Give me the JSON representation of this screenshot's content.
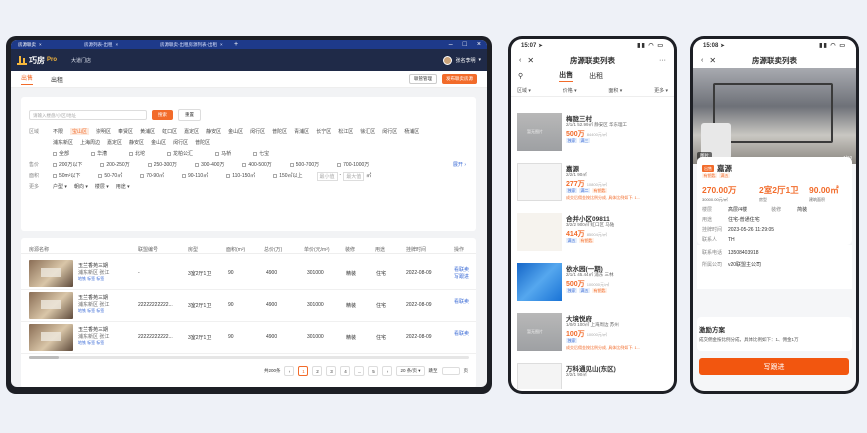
{
  "tablet": {
    "tabs": [
      "房源联卖",
      "房源列表-出租",
      "房源联卖-出租房源列表-出租"
    ],
    "app_name": "巧房",
    "app_suffix": "Pro",
    "store": "大道门店",
    "user": "张名李明",
    "nav": {
      "sale": "出售",
      "rent": "出租",
      "manage_btn": "联管管理",
      "publish_btn": "发布联卖房源"
    },
    "search": {
      "placeholder": "请输入楼盘/小区/地址",
      "search_btn": "搜索",
      "reset_btn": "重置"
    },
    "filters": {
      "area_label": "区域",
      "areas": [
        "不限",
        "宝山区",
        "崇明区",
        "奉贤区",
        "黄浦区",
        "虹口区",
        "嘉定区",
        "静安区",
        "金山区",
        "闵行区",
        "普陀区",
        "青浦区",
        "长宁区",
        "松江区",
        "徐汇区",
        "闵行区",
        "杨浦区"
      ],
      "areas_row2": [
        "浦东新区",
        "上海周边",
        "嘉定区",
        "静安区",
        "金山区",
        "闵行区",
        "普陀区"
      ],
      "types": [
        "全部",
        "华漕",
        "北坨",
        "龙柏公汇",
        "马桥",
        "七宝"
      ],
      "price_label": "售价",
      "prices": [
        "200万以下",
        "200-250万",
        "250-300万",
        "300-400万",
        "400-500万",
        "500-700万",
        "700-1000万"
      ],
      "size_label": "面积",
      "sizes": [
        "50m²以下",
        "50-70㎡",
        "70-90㎡",
        "90-110㎡",
        "110-150㎡",
        "150㎡以上"
      ],
      "min_ph": "最小值",
      "max_ph": "最大值",
      "unit": "㎡",
      "more_label": "更多",
      "more": [
        "户型",
        "朝向",
        "楼层",
        "用途"
      ],
      "expand": "展开"
    },
    "table": {
      "headers": [
        "房源名称",
        "联盟编号",
        "房型",
        "面积(m²)",
        "总价(万)",
        "单价(元/m²)",
        "装修",
        "用途",
        "挂牌时间",
        "操作"
      ],
      "rows": [
        {
          "name": "玉兰香苑三期",
          "loc": "浦东新区 张江",
          "tags": "地铁 标签 标签",
          "code": "-",
          "layout": "3室2厅1卫",
          "area": "90",
          "total": "4900",
          "unit": "301000",
          "deco": "精装",
          "use": "住宅",
          "date": "2022-08-09",
          "op1": "看联卖",
          "op2": "写跟进"
        },
        {
          "name": "玉兰香苑三期",
          "loc": "浦东新区 张江",
          "tags": "地铁 标签 标签",
          "code": "22222222222...",
          "layout": "3室2厅1卫",
          "area": "90",
          "total": "4900",
          "unit": "301000",
          "deco": "精装",
          "use": "住宅",
          "date": "2022-08-09",
          "op1": "看联卖",
          "op2": ""
        },
        {
          "name": "玉兰香苑三期",
          "loc": "浦东新区 张江",
          "tags": "地铁 标签 标签",
          "code": "22222222222...",
          "layout": "3室2厅1卫",
          "area": "90",
          "total": "4900",
          "unit": "301000",
          "deco": "精装",
          "use": "住宅",
          "date": "2022-08-09",
          "op1": "看联卖",
          "op2": ""
        }
      ]
    },
    "pager": {
      "total": "共200条",
      "pages": [
        "1",
        "2",
        "3",
        "4",
        "...",
        "5"
      ],
      "per_page": "20 条/页",
      "goto": "跳至",
      "page_unit": "页"
    }
  },
  "phone1": {
    "time": "15:07",
    "title": "房源联卖列表",
    "tab_sale": "出售",
    "tab_rent": "出租",
    "sorts": [
      "区域",
      "价格",
      "面积",
      "更多"
    ],
    "items": [
      {
        "name": "梅陇三村",
        "info": "2/1/1  52.99㎡  静安区 华东理工",
        "price": "500万",
        "unit": "84400元/㎡",
        "tags": [
          "独家",
          "满三"
        ],
        "note": "",
        "thumb": "blur1",
        "ph": "暂无图片"
      },
      {
        "name": "嘉源",
        "info": "2/2/1  90㎡",
        "price": "277万",
        "unit": "10800元/㎡",
        "tags": [
          "独家",
          "满二",
          "有钥匙"
        ],
        "note": "成交后佣金按比例分成, 具体比例如下: 1...",
        "thumb": "doc",
        "ph": ""
      },
      {
        "name": "合并小区09811",
        "info": "3/2/2  900㎡  虹口区 马陆",
        "price": "414万",
        "unit": "85004元/㎡",
        "tags": [
          "满五",
          "有钥匙"
        ],
        "note": "",
        "thumb": "plan",
        "ph": ""
      },
      {
        "name": "依水园(一期)",
        "info": "2/1/1  45.44㎡  浦东 三林",
        "price": "500万",
        "unit": "100000元/㎡",
        "tags": [
          "独家",
          "满五",
          "有钥匙"
        ],
        "note": "",
        "thumb": "win",
        "ph": ""
      },
      {
        "name": "大境悦府",
        "info": "1/0/0  100㎡  上海周边 苏州",
        "price": "100万",
        "unit": "10000元/㎡",
        "tags": [
          "独家"
        ],
        "note": "成交后佣金按比例分成, 具体比例如下: 1...",
        "thumb": "blur1",
        "ph": "暂无图片"
      },
      {
        "name": "万科通见山(东区)",
        "info": "2/2/1  90㎡",
        "price": "",
        "unit": "",
        "tags": [],
        "note": "",
        "thumb": "doc",
        "ph": ""
      }
    ]
  },
  "phone2": {
    "time": "15:08",
    "title": "房源联卖列表",
    "img_label": "图片",
    "img_count": "1/10",
    "tag": "出售",
    "name": "嘉源",
    "tags": [
      "有钥匙",
      "满五"
    ],
    "price": "270.00万",
    "price_sub": "30000.00元/㎡",
    "layout": "2室2厅1卫",
    "layout_sub": "房型",
    "area": "90.00㎡",
    "area_sub": "建筑面积",
    "details": [
      {
        "k": "楼层",
        "v": "高层/4楼"
      },
      {
        "k": "用途",
        "v": "住宅-普通住宅"
      },
      {
        "k": "挂牌时间",
        "v": "2023-05-26 11:29:05"
      },
      {
        "k": "联系人",
        "v": "TH"
      },
      {
        "k": "联系电话",
        "v": "13508403918"
      },
      {
        "k": "所属公司",
        "v": "v20联盟主公司"
      }
    ],
    "deco_k": "装修",
    "deco_v": "简装",
    "incentive_title": "激励方案",
    "incentive_text": "成交佣金按比例分成，具体比例如下：1、佣金1万",
    "cta": "写跟进"
  }
}
